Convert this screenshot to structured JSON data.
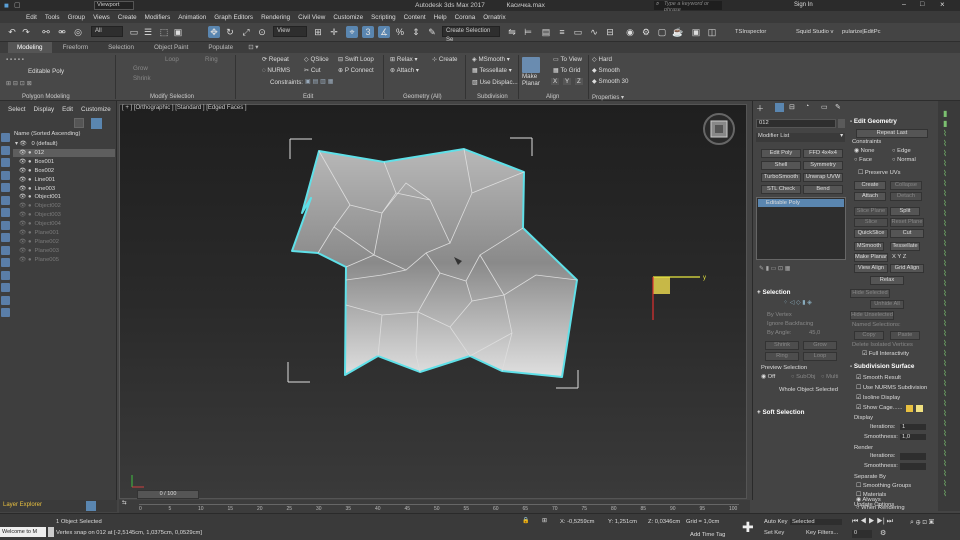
{
  "window": {
    "title": "Autodesk 3ds Max 2017",
    "file": "Касичка.max",
    "viewport_dd": "Viewport",
    "search": "Type a keyword or phrase",
    "signin": "Sign In"
  },
  "menu": [
    "Edit",
    "Tools",
    "Group",
    "Views",
    "Create",
    "Modifiers",
    "Animation",
    "Graph Editors",
    "Rendering",
    "Civil View",
    "Customize",
    "Scripting",
    "Content",
    "Help",
    "Corona",
    "Ornatrix"
  ],
  "toolbar": {
    "all": "All",
    "view": "View",
    "selset": "Create Selection Se",
    "ts": "TSInspector",
    "studio": "Squid Studio v",
    "pularize": "pularize|EditPc"
  },
  "ribbon_tabs": [
    "Modeling",
    "Freeform",
    "Selection",
    "Object Paint",
    "Populate"
  ],
  "ribbon": {
    "editable_poly": "Editable Poly",
    "polygon_modeling": "Polygon Modeling",
    "modify_selection": "Modify Selection",
    "edit": "Edit",
    "geometry": "Geometry (All)",
    "subdivision": "Subdivision",
    "align": "Align",
    "properties": "Properties",
    "grow": "Grow",
    "shrink": "Shrink",
    "loop": "Loop",
    "ring": "Ring",
    "repeat": "Repeat",
    "qslice": "QSlice",
    "swiftloop": "Swift Loop",
    "nurms": "NURMS",
    "cut": "Cut",
    "pconnect": "P Connect",
    "constraints": "Constraints:",
    "relax": "Relax",
    "create": "Create",
    "attach": "Attach",
    "msmooth": "MSmooth",
    "tessellate": "Tessellate",
    "usedisplac": "Use Displac...",
    "make_planar": "Make Planar",
    "to_view": "To View",
    "to_grid": "To Grid",
    "hard": "Hard",
    "smooth": "Smooth",
    "smooth30": "Smooth 30",
    "x": "X",
    "y": "Y",
    "z": "Z"
  },
  "scene": {
    "tabs": [
      "Select",
      "Display",
      "Edit",
      "Customize"
    ],
    "header": "Name (Sorted Ascending)",
    "items": [
      {
        "name": "0 (default)",
        "dim": false,
        "sel": false
      },
      {
        "name": "012",
        "dim": false,
        "sel": true
      },
      {
        "name": "Box001",
        "dim": false,
        "sel": false
      },
      {
        "name": "Box002",
        "dim": false,
        "sel": false
      },
      {
        "name": "Line001",
        "dim": false,
        "sel": false
      },
      {
        "name": "Line003",
        "dim": false,
        "sel": false
      },
      {
        "name": "Object001",
        "dim": false,
        "sel": false
      },
      {
        "name": "Object002",
        "dim": true,
        "sel": false
      },
      {
        "name": "Object003",
        "dim": true,
        "sel": false
      },
      {
        "name": "Object004",
        "dim": true,
        "sel": false
      },
      {
        "name": "Plane001",
        "dim": true,
        "sel": false
      },
      {
        "name": "Plane002",
        "dim": true,
        "sel": false
      },
      {
        "name": "Plane003",
        "dim": true,
        "sel": false
      },
      {
        "name": "Plane005",
        "dim": true,
        "sel": false
      }
    ],
    "layer_explorer": "Layer Explorer"
  },
  "viewport": {
    "label": "[ + ] [Orthographic ] [Standard ] [Edged Faces ]",
    "axis_y": "y",
    "axis_x": "x"
  },
  "cmd": {
    "object_name": "012",
    "modifier_list": "Modifier List",
    "mods": [
      "Edit Poly",
      "FFD 4x4x4",
      "Shell",
      "Symmetry",
      "TurboSmooth",
      "Unwrap UVW",
      "STL Check",
      "Bend"
    ],
    "stack_item": "Editable Poly",
    "selection": "Selection",
    "by_vertex": "By Vertex",
    "ignore_backfacing": "Ignore Backfacing",
    "by_angle": "By Angle:",
    "angle_val": "45,0",
    "shrink": "Shrink",
    "grow": "Grow",
    "ring": "Ring",
    "loop": "Loop",
    "preview_selection": "Preview Selection",
    "off": "Off",
    "subobj": "SubObj",
    "multi": "Multi",
    "whole": "Whole Object Selected",
    "soft": "Soft Selection"
  },
  "rpanel": {
    "edit_geometry": "Edit Geometry",
    "repeat_last": "Repeat Last",
    "constraints": "Constraints",
    "none": "None",
    "edge": "Edge",
    "face": "Face",
    "normal": "Normal",
    "preserve_uvs": "Preserve UVs",
    "create": "Create",
    "collapse": "Collapse",
    "attach": "Attach",
    "detach": "Detach",
    "slice_plane": "Slice Plane",
    "split": "Split",
    "slice": "Slice",
    "reset_plane": "Reset Plane",
    "quickslice": "QuickSlice",
    "cut": "Cut",
    "msmooth": "MSmooth",
    "tessellate": "Tessellate",
    "make_planar": "Make Planar",
    "x": "X",
    "y": "Y",
    "z": "Z",
    "view_align": "View Align",
    "grid_align": "Grid Align",
    "relax": "Relax",
    "hide_sel": "Hide Selected",
    "unhide_all": "Unhide All",
    "hide_unsel": "Hide Unselected",
    "named_sel": "Named Selections:",
    "copy": "Copy",
    "paste": "Paste",
    "delete_iso": "Delete Isolated Vertices",
    "full_interactivity": "Full Interactivity",
    "subdivision_surface": "Subdivision Surface",
    "smooth_result": "Smooth Result",
    "use_nurms": "Use NURMS Subdivision",
    "isoline": "Isoline Display",
    "show_cage": "Show Cage......",
    "display": "Display",
    "iterations": "Iterations:",
    "iter_val": "1",
    "smoothness": "Smoothness:",
    "smooth_val": "1,0",
    "render": "Render",
    "separate_by": "Separate By",
    "smoothing_groups": "Smoothing Groups",
    "materials": "Materials",
    "update_options": "Update Options",
    "always": "Always",
    "when_rendering": "When Rendering"
  },
  "timeline": {
    "frame": "0 / 100",
    "ticks": [
      "0",
      "5",
      "10",
      "15",
      "20",
      "25",
      "30",
      "35",
      "40",
      "45",
      "50",
      "55",
      "60",
      "65",
      "70",
      "75",
      "80",
      "85",
      "90",
      "95",
      "100"
    ]
  },
  "status": {
    "maxscript": "Welcome to M",
    "selected": "1 Object Selected",
    "snap": "Vertex snap on 012 at [-2,5145cm, 1,0375cm, 0,0529cm]",
    "x": "X: -0,5259cm",
    "y": "Y: 1,251cm",
    "z": "Z: 0,0346cm",
    "grid": "Grid = 1,0cm",
    "add_time_tag": "Add Time Tag",
    "autokey": "Auto Key",
    "setkey": "Set Key",
    "selected_dd": "Selected",
    "key_filters": "Key Filters...",
    "frame_val": "0"
  }
}
